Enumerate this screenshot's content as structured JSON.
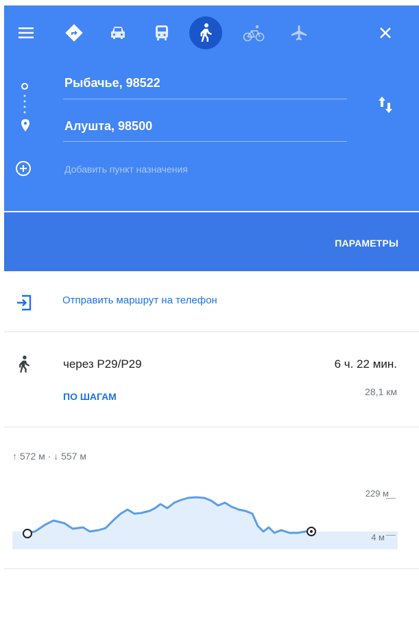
{
  "header": {
    "icons": [
      "menu-icon",
      "driving-icon",
      "car-icon",
      "transit-icon",
      "walking-icon",
      "cycling-icon",
      "flight-icon",
      "close-icon"
    ],
    "origin": "Рыбачье, 98522",
    "destination": "Алушта, 98500",
    "add_destination_placeholder": "Добавить пункт назначения",
    "settings_label": "ПАРАМЕТРЫ",
    "colors": {
      "header": "#4285f4",
      "settings_bar": "#3b78e7",
      "active_mode": "#1a56c9",
      "link": "#1a73e8"
    }
  },
  "send": {
    "label": "Отправить маршрут на телефон"
  },
  "route": {
    "via": "через Р29/Р29",
    "duration": "6 ч. 22 мин.",
    "distance": "28,1 км",
    "steps_label": "ПО ШАГАМ"
  },
  "elevation": {
    "summary": "↑ 572 м · ↓ 557 м",
    "max_label": "229 м",
    "min_label": "4 м"
  }
}
